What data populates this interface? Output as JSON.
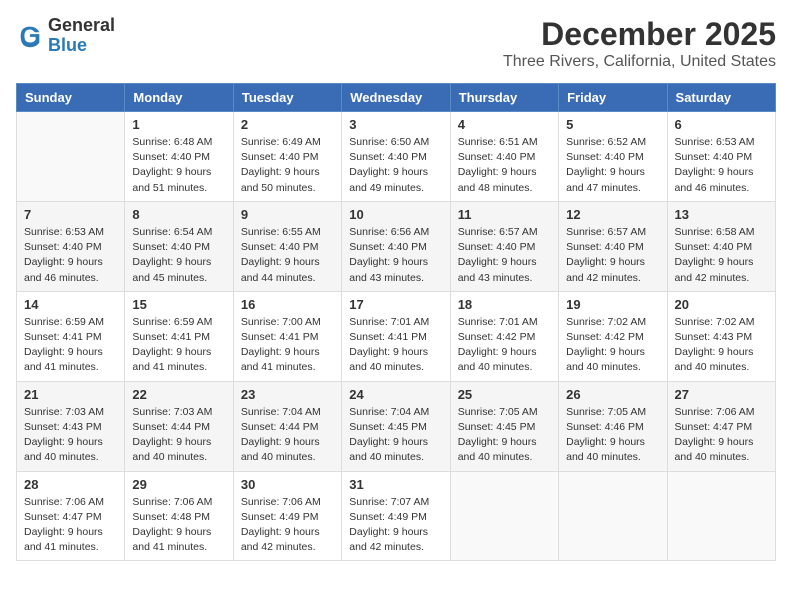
{
  "header": {
    "logo_line1": "General",
    "logo_line2": "Blue",
    "month_title": "December 2025",
    "location": "Three Rivers, California, United States"
  },
  "columns": [
    "Sunday",
    "Monday",
    "Tuesday",
    "Wednesday",
    "Thursday",
    "Friday",
    "Saturday"
  ],
  "weeks": [
    [
      {
        "day": null,
        "info": null
      },
      {
        "day": "1",
        "info": "Sunrise: 6:48 AM\nSunset: 4:40 PM\nDaylight: 9 hours\nand 51 minutes."
      },
      {
        "day": "2",
        "info": "Sunrise: 6:49 AM\nSunset: 4:40 PM\nDaylight: 9 hours\nand 50 minutes."
      },
      {
        "day": "3",
        "info": "Sunrise: 6:50 AM\nSunset: 4:40 PM\nDaylight: 9 hours\nand 49 minutes."
      },
      {
        "day": "4",
        "info": "Sunrise: 6:51 AM\nSunset: 4:40 PM\nDaylight: 9 hours\nand 48 minutes."
      },
      {
        "day": "5",
        "info": "Sunrise: 6:52 AM\nSunset: 4:40 PM\nDaylight: 9 hours\nand 47 minutes."
      },
      {
        "day": "6",
        "info": "Sunrise: 6:53 AM\nSunset: 4:40 PM\nDaylight: 9 hours\nand 46 minutes."
      }
    ],
    [
      {
        "day": "7",
        "info": "Sunrise: 6:53 AM\nSunset: 4:40 PM\nDaylight: 9 hours\nand 46 minutes."
      },
      {
        "day": "8",
        "info": "Sunrise: 6:54 AM\nSunset: 4:40 PM\nDaylight: 9 hours\nand 45 minutes."
      },
      {
        "day": "9",
        "info": "Sunrise: 6:55 AM\nSunset: 4:40 PM\nDaylight: 9 hours\nand 44 minutes."
      },
      {
        "day": "10",
        "info": "Sunrise: 6:56 AM\nSunset: 4:40 PM\nDaylight: 9 hours\nand 43 minutes."
      },
      {
        "day": "11",
        "info": "Sunrise: 6:57 AM\nSunset: 4:40 PM\nDaylight: 9 hours\nand 43 minutes."
      },
      {
        "day": "12",
        "info": "Sunrise: 6:57 AM\nSunset: 4:40 PM\nDaylight: 9 hours\nand 42 minutes."
      },
      {
        "day": "13",
        "info": "Sunrise: 6:58 AM\nSunset: 4:40 PM\nDaylight: 9 hours\nand 42 minutes."
      }
    ],
    [
      {
        "day": "14",
        "info": "Sunrise: 6:59 AM\nSunset: 4:41 PM\nDaylight: 9 hours\nand 41 minutes."
      },
      {
        "day": "15",
        "info": "Sunrise: 6:59 AM\nSunset: 4:41 PM\nDaylight: 9 hours\nand 41 minutes."
      },
      {
        "day": "16",
        "info": "Sunrise: 7:00 AM\nSunset: 4:41 PM\nDaylight: 9 hours\nand 41 minutes."
      },
      {
        "day": "17",
        "info": "Sunrise: 7:01 AM\nSunset: 4:41 PM\nDaylight: 9 hours\nand 40 minutes."
      },
      {
        "day": "18",
        "info": "Sunrise: 7:01 AM\nSunset: 4:42 PM\nDaylight: 9 hours\nand 40 minutes."
      },
      {
        "day": "19",
        "info": "Sunrise: 7:02 AM\nSunset: 4:42 PM\nDaylight: 9 hours\nand 40 minutes."
      },
      {
        "day": "20",
        "info": "Sunrise: 7:02 AM\nSunset: 4:43 PM\nDaylight: 9 hours\nand 40 minutes."
      }
    ],
    [
      {
        "day": "21",
        "info": "Sunrise: 7:03 AM\nSunset: 4:43 PM\nDaylight: 9 hours\nand 40 minutes."
      },
      {
        "day": "22",
        "info": "Sunrise: 7:03 AM\nSunset: 4:44 PM\nDaylight: 9 hours\nand 40 minutes."
      },
      {
        "day": "23",
        "info": "Sunrise: 7:04 AM\nSunset: 4:44 PM\nDaylight: 9 hours\nand 40 minutes."
      },
      {
        "day": "24",
        "info": "Sunrise: 7:04 AM\nSunset: 4:45 PM\nDaylight: 9 hours\nand 40 minutes."
      },
      {
        "day": "25",
        "info": "Sunrise: 7:05 AM\nSunset: 4:45 PM\nDaylight: 9 hours\nand 40 minutes."
      },
      {
        "day": "26",
        "info": "Sunrise: 7:05 AM\nSunset: 4:46 PM\nDaylight: 9 hours\nand 40 minutes."
      },
      {
        "day": "27",
        "info": "Sunrise: 7:06 AM\nSunset: 4:47 PM\nDaylight: 9 hours\nand 40 minutes."
      }
    ],
    [
      {
        "day": "28",
        "info": "Sunrise: 7:06 AM\nSunset: 4:47 PM\nDaylight: 9 hours\nand 41 minutes."
      },
      {
        "day": "29",
        "info": "Sunrise: 7:06 AM\nSunset: 4:48 PM\nDaylight: 9 hours\nand 41 minutes."
      },
      {
        "day": "30",
        "info": "Sunrise: 7:06 AM\nSunset: 4:49 PM\nDaylight: 9 hours\nand 42 minutes."
      },
      {
        "day": "31",
        "info": "Sunrise: 7:07 AM\nSunset: 4:49 PM\nDaylight: 9 hours\nand 42 minutes."
      },
      {
        "day": null,
        "info": null
      },
      {
        "day": null,
        "info": null
      },
      {
        "day": null,
        "info": null
      }
    ]
  ]
}
